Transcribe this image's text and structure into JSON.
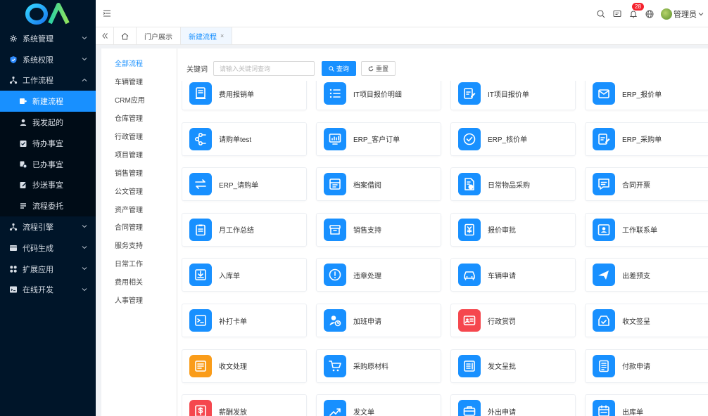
{
  "sidebar": {
    "items": [
      {
        "label": "系统管理",
        "icon": "gear-icon",
        "chevron": "down"
      },
      {
        "label": "系统权限",
        "icon": "shield-icon",
        "chevron": "down"
      },
      {
        "label": "工作流程",
        "icon": "workflow-icon",
        "chevron": "up"
      },
      {
        "label": "新建流程",
        "icon": "new-flow-icon",
        "sub": true,
        "active": true
      },
      {
        "label": "我发起的",
        "icon": "user-icon",
        "sub": true
      },
      {
        "label": "待办事宜",
        "icon": "todo-icon",
        "sub": true
      },
      {
        "label": "已办事宜",
        "icon": "done-icon",
        "sub": true
      },
      {
        "label": "抄送事宜",
        "icon": "cc-icon",
        "sub": true
      },
      {
        "label": "流程委托",
        "icon": "delegate-icon",
        "sub": true
      },
      {
        "label": "流程引擎",
        "icon": "engine-icon",
        "chevron": "down"
      },
      {
        "label": "代码生成",
        "icon": "code-icon",
        "chevron": "down"
      },
      {
        "label": "扩展应用",
        "icon": "apps-icon",
        "chevron": "down"
      },
      {
        "label": "在线开发",
        "icon": "dev-icon",
        "chevron": "down"
      }
    ]
  },
  "header": {
    "notification_count": "28",
    "user_name": "管理员"
  },
  "tabs": {
    "items": [
      {
        "label": "门户展示",
        "active": false
      },
      {
        "label": "新建流程",
        "active": true,
        "close": "×"
      }
    ]
  },
  "categories": [
    "全部流程",
    "车辆管理",
    "CRM应用",
    "仓库管理",
    "行政管理",
    "项目管理",
    "销售管理",
    "公文管理",
    "资产管理",
    "合同管理",
    "服务支持",
    "日常工作",
    "费用相关",
    "人事管理"
  ],
  "search": {
    "label": "关键词",
    "placeholder": "请输入关键词查询",
    "query_label": "查询",
    "reset_label": "重置"
  },
  "processes": [
    {
      "name": "费用报销单",
      "icon": "receipt-icon",
      "color": "#1890ff"
    },
    {
      "name": "IT项目报价明细",
      "icon": "list-icon",
      "color": "#1890ff"
    },
    {
      "name": "IT项目报价单",
      "icon": "edit-doc-icon",
      "color": "#1890ff"
    },
    {
      "name": "ERP_报价单",
      "icon": "mail-icon",
      "color": "#1890ff"
    },
    {
      "name": "请购单test",
      "icon": "flow-icon",
      "color": "#1890ff"
    },
    {
      "name": "ERP_客户订单",
      "icon": "monitor-icon",
      "color": "#1890ff"
    },
    {
      "name": "ERP_核价单",
      "icon": "check-circle-icon",
      "color": "#1890ff"
    },
    {
      "name": "ERP_采购单",
      "icon": "edit-doc-icon",
      "color": "#1890ff"
    },
    {
      "name": "ERP_请购单",
      "icon": "transfer-icon",
      "color": "#1890ff"
    },
    {
      "name": "档案借阅",
      "icon": "archive-icon",
      "color": "#1890ff"
    },
    {
      "name": "日常物品采购",
      "icon": "money-doc-icon",
      "color": "#1890ff"
    },
    {
      "name": "合同开票",
      "icon": "message-icon",
      "color": "#1890ff"
    },
    {
      "name": "月工作总结",
      "icon": "clipboard-icon",
      "color": "#1890ff"
    },
    {
      "name": "销售支持",
      "icon": "box-icon",
      "color": "#1890ff"
    },
    {
      "name": "报价审批",
      "icon": "yen-doc-icon",
      "color": "#1890ff"
    },
    {
      "name": "工作联系单",
      "icon": "contact-card-icon",
      "color": "#1890ff"
    },
    {
      "name": "入库单",
      "icon": "inbox-icon",
      "color": "#1890ff"
    },
    {
      "name": "违章处理",
      "icon": "alert-icon",
      "color": "#1890ff"
    },
    {
      "name": "车辆申请",
      "icon": "car-icon",
      "color": "#1890ff"
    },
    {
      "name": "出差预支",
      "icon": "plane-icon",
      "color": "#1890ff"
    },
    {
      "name": "补打卡单",
      "icon": "punch-card-icon",
      "color": "#1890ff"
    },
    {
      "name": "加班申请",
      "icon": "user-clock-icon",
      "color": "#1890ff"
    },
    {
      "name": "行政赏罚",
      "icon": "id-card-icon",
      "color": "#f5474e"
    },
    {
      "name": "收文签呈",
      "icon": "inbox-check-icon",
      "color": "#1890ff"
    },
    {
      "name": "收文处理",
      "icon": "file-text-icon",
      "color": "#fa9c19"
    },
    {
      "name": "采购原材料",
      "icon": "cart-icon",
      "color": "#1890ff"
    },
    {
      "name": "发文呈批",
      "icon": "doc-lines-icon",
      "color": "#1890ff"
    },
    {
      "name": "付款申请",
      "icon": "form-icon",
      "color": "#1890ff"
    },
    {
      "name": "薪酬发放",
      "icon": "dollar-icon",
      "color": "#f5474e"
    },
    {
      "name": "发文单",
      "icon": "chart-up-icon",
      "color": "#1890ff"
    },
    {
      "name": "外出申请",
      "icon": "briefcase-icon",
      "color": "#1890ff"
    },
    {
      "name": "出库单",
      "icon": "calendar-icon",
      "color": "#1890ff"
    }
  ]
}
